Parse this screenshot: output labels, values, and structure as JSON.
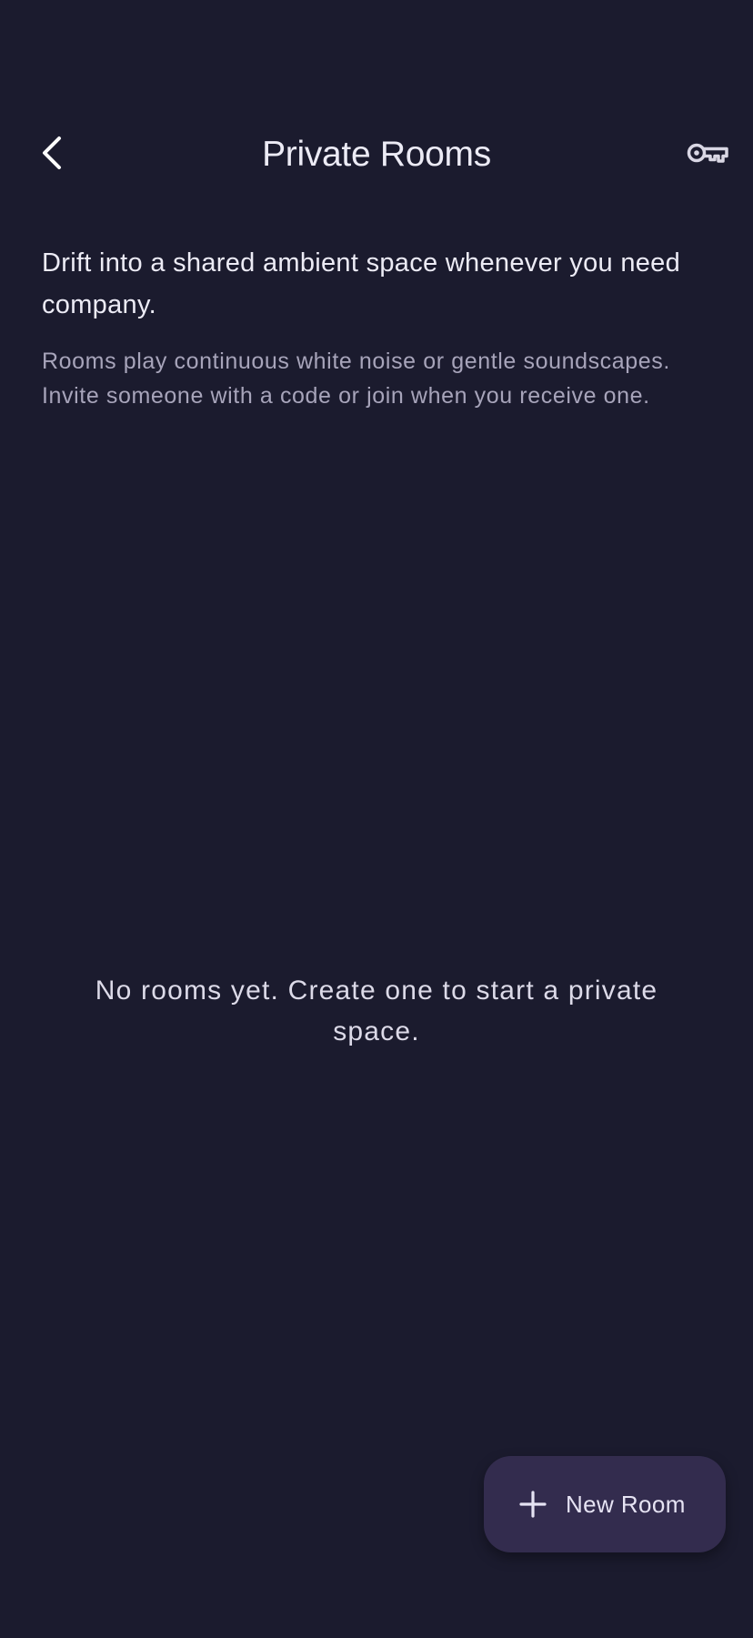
{
  "header": {
    "title": "Private Rooms",
    "back_icon": "chevron-left-icon",
    "action_icon": "key-icon"
  },
  "intro": {
    "headline": "Drift into a shared ambient space whenever you need company.",
    "body": "Rooms play continuous white noise or gentle soundscapes. Invite someone with a code or join when you receive one."
  },
  "empty_state": {
    "message": "No rooms yet. Create one to start a private space."
  },
  "fab": {
    "label": "New Room",
    "icon": "plus-icon"
  },
  "colors": {
    "background": "#1b1b2e",
    "fab_background": "#332c4e",
    "primary_text": "#ecebf5",
    "secondary_text": "#a7a4ba"
  }
}
